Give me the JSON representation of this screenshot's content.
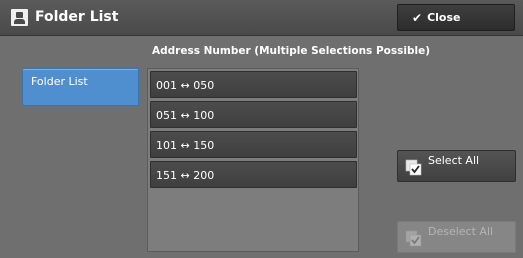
{
  "titlebar": {
    "title": "Folder List",
    "title_icon": "folder-list-icon",
    "close_label": "Close",
    "close_icon": "checkmark-icon"
  },
  "left_tabs": [
    {
      "label": "Folder List",
      "selected": true
    }
  ],
  "list": {
    "heading": "Address Number (Multiple Selections Possible)",
    "items": [
      {
        "label": "001 ↔ 050"
      },
      {
        "label": "051 ↔ 100"
      },
      {
        "label": "101 ↔ 150"
      },
      {
        "label": "151 ↔ 200"
      }
    ]
  },
  "actions": {
    "select_all": {
      "label": "Select All",
      "icon": "select-all-icon",
      "enabled": true
    },
    "deselect_all": {
      "label": "Deselect All",
      "icon": "deselect-all-icon",
      "enabled": false
    }
  },
  "colors": {
    "accent_tab": "#4f8fd0",
    "background": "#6f6f6f",
    "titlebar": "#4a4a4a"
  }
}
